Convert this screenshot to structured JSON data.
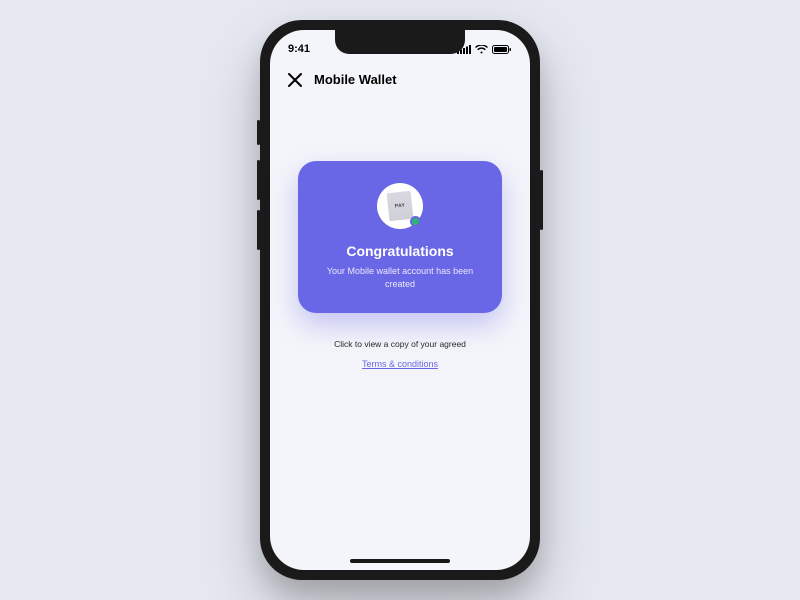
{
  "statusbar": {
    "time": "9:41"
  },
  "header": {
    "title": "Mobile Wallet"
  },
  "card": {
    "badge_text": "PAY",
    "title": "Congratulations",
    "subtitle": "Your Mobile wallet account has been created"
  },
  "terms": {
    "intro": "Click to view a copy of your agreed",
    "link_label": "Terms & conditions"
  },
  "colors": {
    "accent": "#6a67e6",
    "success": "#2bb673"
  }
}
